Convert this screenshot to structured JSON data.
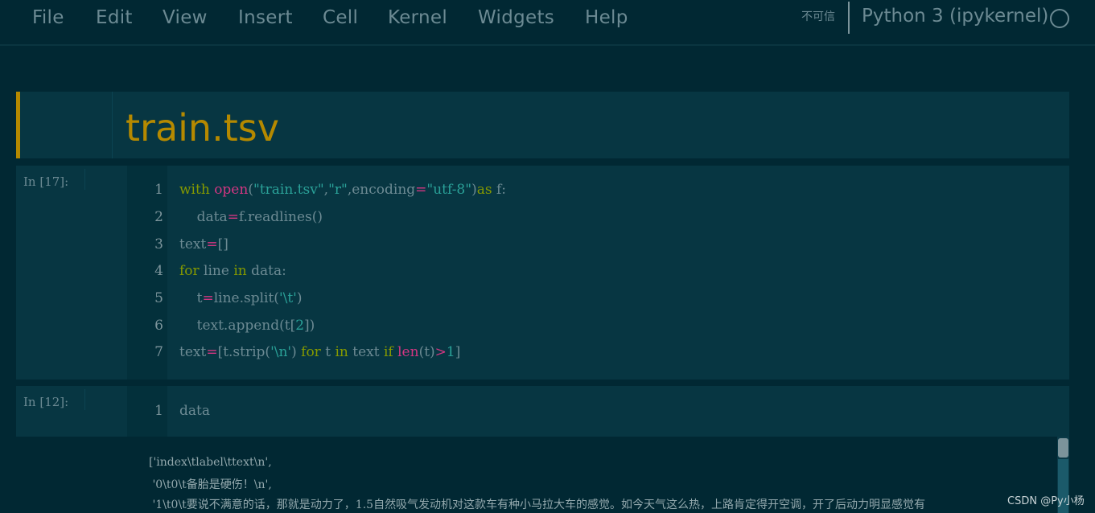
{
  "menu": {
    "items": [
      "File",
      "Edit",
      "View",
      "Insert",
      "Cell",
      "Kernel",
      "Widgets",
      "Help"
    ],
    "trust_label": "不可信",
    "kernel_name": "Python 3 (ipykernel)",
    "kernel_status_icon": "circle-idle-icon"
  },
  "markdown_cell": {
    "title": "train.tsv"
  },
  "cells": [
    {
      "prompt": "In  [17]:",
      "line_numbers": [
        "1",
        "2",
        "3",
        "4",
        "5",
        "6",
        "7"
      ]
    },
    {
      "prompt": "In  [12]:",
      "line_numbers": [
        "1"
      ],
      "code": "data"
    }
  ],
  "output": {
    "lines": [
      "['index\\tlabel\\ttext\\n',",
      " '0\\t0\\t备胎是硬伤！\\n',",
      " '1\\t0\\t要说不满意的话，那就是动力了，1.5自然吸气发动机对这款车有种小马拉大车的感觉。如今天气这么热，上路肯定得开空调，开了后动力明显感觉有"
    ]
  },
  "watermark": "CSDN @Py小杨",
  "colors": {
    "background": "#012833",
    "cell_background": "#073642",
    "accent": "#b58900",
    "keyword": "#859900",
    "builtin": "#d33682",
    "string": "#2aa198",
    "text": "#6c8a93"
  }
}
